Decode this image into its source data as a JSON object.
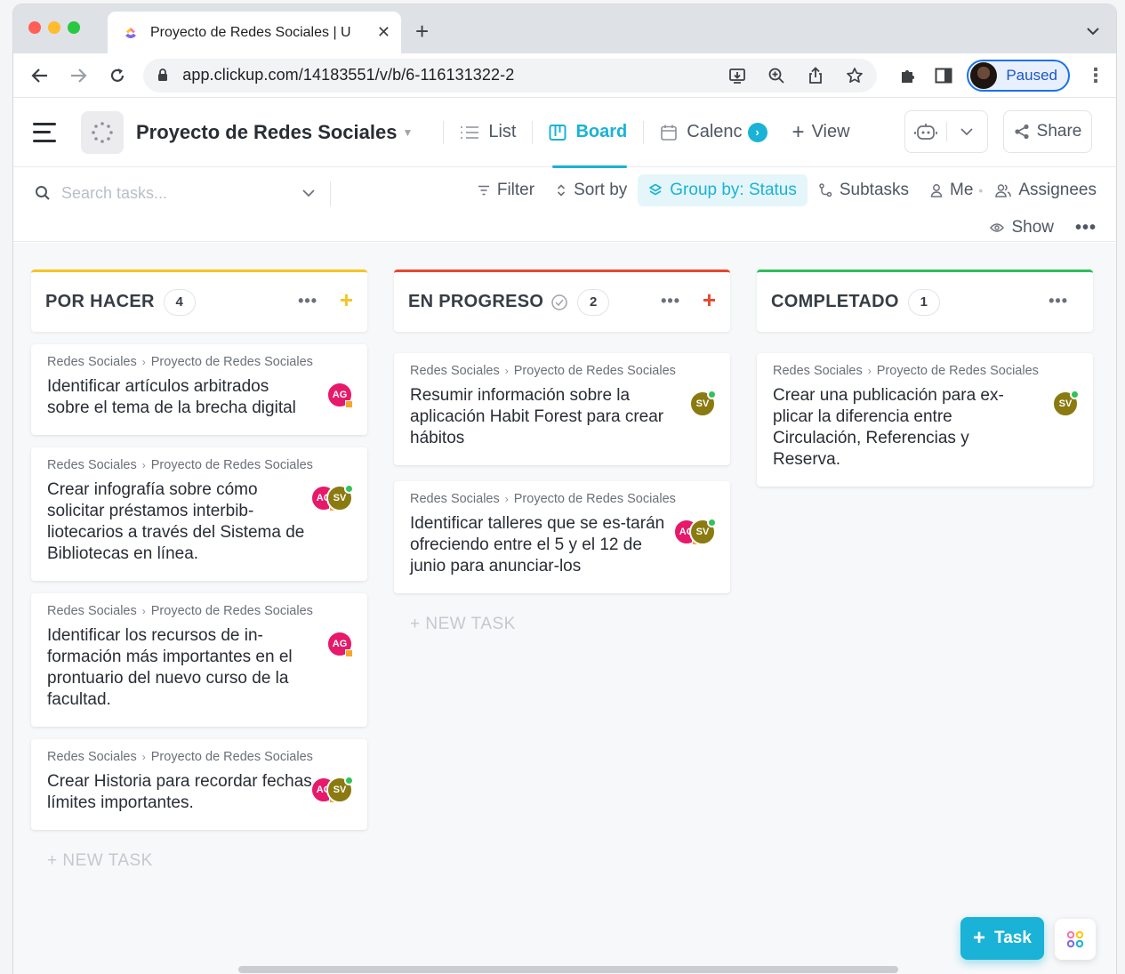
{
  "browser": {
    "tab_title": "Proyecto de Redes Sociales | U",
    "url": "app.clickup.com/14183551/v/b/6-116131322-2",
    "profile_label": "Paused"
  },
  "header": {
    "project_title": "Proyecto de Redes Sociales",
    "views": [
      {
        "label": "List",
        "icon": "list-icon",
        "active": false
      },
      {
        "label": "Board",
        "icon": "board-icon",
        "active": true
      },
      {
        "label": "Calenc",
        "icon": "calendar-icon",
        "active": false
      }
    ],
    "add_view_label": "View",
    "share_label": "Share"
  },
  "filterbar": {
    "search_placeholder": "Search tasks...",
    "filter_label": "Filter",
    "sort_label": "Sort by",
    "group_label": "Group by: Status",
    "subtasks_label": "Subtasks",
    "me_label": "Me",
    "assignees_label": "Assignees",
    "show_label": "Show"
  },
  "colors": {
    "accent": "#1ab2d6",
    "todo": "#f5c623",
    "in_progress": "#e8462e",
    "done": "#2fbf5b"
  },
  "columns": [
    {
      "name": "POR HACER",
      "count": "4",
      "tasks": [
        {
          "path_a": "Redes Sociales",
          "path_b": "Proyecto de Redes Sociales",
          "title": "Identificar artículos arbitrados sobre el tema de la brecha digital",
          "assignees": [
            "AG"
          ]
        },
        {
          "path_a": "Redes Sociales",
          "path_b": "Proyecto de Redes Sociales",
          "title": "Crear infografía sobre cómo solicitar préstamos interbib-liotecarios a través del Sistema de Bibliotecas en línea.",
          "assignees": [
            "AG",
            "SV"
          ]
        },
        {
          "path_a": "Redes Sociales",
          "path_b": "Proyecto de Redes Sociales",
          "title": "Identificar los recursos de in-formación más importantes en el prontuario del nuevo curso de la facultad.",
          "assignees": [
            "AG"
          ]
        },
        {
          "path_a": "Redes Sociales",
          "path_b": "Proyecto de Redes Sociales",
          "title": "Crear Historia para recordar fechas límites importantes.",
          "assignees": [
            "AG",
            "SV"
          ]
        }
      ],
      "new_task_label": "+ NEW TASK"
    },
    {
      "name": "EN PROGRESO",
      "count": "2",
      "tasks": [
        {
          "path_a": "Redes Sociales",
          "path_b": "Proyecto de Redes Sociales",
          "title": "Resumir información sobre la aplicación Habit Forest para crear hábitos",
          "assignees": [
            "SV"
          ]
        },
        {
          "path_a": "Redes Sociales",
          "path_b": "Proyecto de Redes Sociales",
          "title": "Identificar talleres que se es-tarán ofreciendo entre el 5 y el 12 de junio para anunciar-los",
          "assignees": [
            "AG",
            "SV"
          ]
        }
      ],
      "new_task_label": "+ NEW TASK"
    },
    {
      "name": "COMPLETADO",
      "count": "1",
      "tasks": [
        {
          "path_a": "Redes Sociales",
          "path_b": "Proyecto de Redes Sociales",
          "title": "Crear una publicación para ex-plicar la diferencia entre Circulación, Referencias y Reserva.",
          "assignees": [
            "SV"
          ]
        }
      ]
    }
  ],
  "fab": {
    "task_label": "Task"
  }
}
